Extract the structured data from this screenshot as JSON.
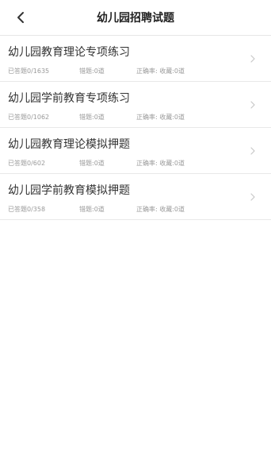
{
  "header": {
    "title": "幼儿园招聘试题"
  },
  "items": [
    {
      "title": "幼儿园教育理论专项练习",
      "done": "已答题0/1635",
      "wrong": "错题:0道",
      "rate": "正确率: 收藏:0道"
    },
    {
      "title": "幼儿园学前教育专项练习",
      "done": "已答题0/1062",
      "wrong": "错题:0道",
      "rate": "正确率: 收藏:0道"
    },
    {
      "title": "幼儿园教育理论模拟押题",
      "done": "已答题0/602",
      "wrong": "错题:0道",
      "rate": "正确率: 收藏:0道"
    },
    {
      "title": "幼儿园学前教育模拟押题",
      "done": "已答题0/358",
      "wrong": "错题:0道",
      "rate": "正确率: 收藏:0道"
    }
  ],
  "icons": {
    "back": "back-arrow-icon",
    "chevron": "chevron-right-icon"
  },
  "colors": {
    "title_text": "#333333",
    "meta_text": "#9a9a9a",
    "divider": "#e8e8e8",
    "background": "#ffffff"
  }
}
